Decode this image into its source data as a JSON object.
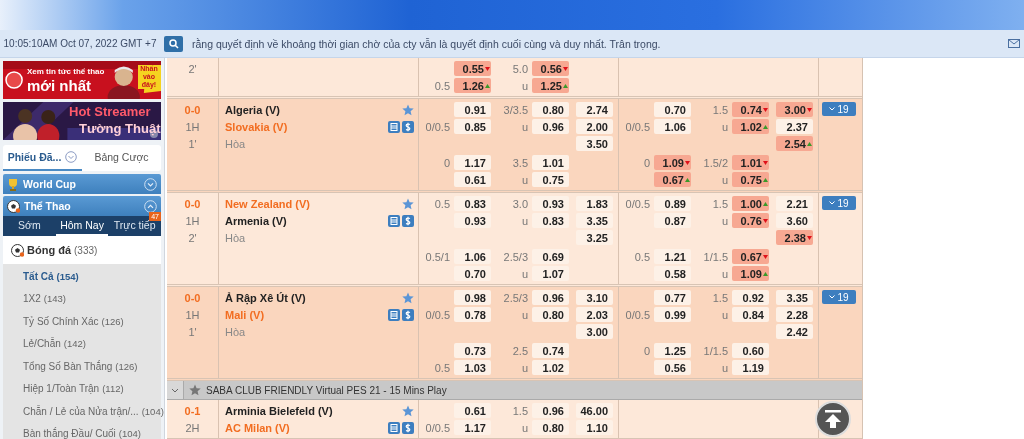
{
  "header": {
    "clock": "10:05:10AM Oct 07, 2022 GMT +7",
    "notice": "rằng quyết định về khoảng thời gian chờ của cty vẫn là quyết định cuối cùng và duy nhất. Trân trọng."
  },
  "sidebar": {
    "banners": [
      {
        "kind": "news",
        "lines": [
          "Xem tin tức thể thao",
          "mới nhất"
        ],
        "tag": "Nhấn vào đây!"
      },
      {
        "kind": "stream",
        "lines": [
          "Hot Streamer",
          "Tường Thuật"
        ]
      }
    ],
    "tabs": [
      {
        "label": "Phiếu Đã...",
        "selected": true
      },
      {
        "label": "Bảng Cược",
        "selected": false
      }
    ],
    "sections": [
      {
        "title": "World Cup",
        "kind": "trophy",
        "expanded": false
      },
      {
        "title": "Thể Thao",
        "kind": "ball",
        "expanded": true
      }
    ],
    "subtabs": [
      {
        "label": "Sớm",
        "selected": false
      },
      {
        "label": "Hôm Nay",
        "selected": true
      },
      {
        "label": "Trực tiếp",
        "selected": false,
        "badge": "47"
      }
    ],
    "sport": {
      "name": "Bóng đá",
      "count": "(333)"
    },
    "bet_types": [
      {
        "label": "Tất Cả",
        "count": "(154)",
        "selected": true
      },
      {
        "label": "1X2",
        "count": "(143)",
        "selected": false
      },
      {
        "label": "Tỷ Số Chính Xác",
        "count": "(126)",
        "selected": false
      },
      {
        "label": "Lẻ/Chẵn",
        "count": "(142)",
        "selected": false
      },
      {
        "label": "Tổng Số Bàn Thắng",
        "count": "(126)",
        "selected": false
      },
      {
        "label": "Hiệp 1/Toàn Trận",
        "count": "(112)",
        "selected": false
      },
      {
        "label": "Chẵn / Lẻ của Nửa trận/...",
        "count": "(104)",
        "selected": false
      },
      {
        "label": "Bàn thắng Đầu/ Cuối",
        "count": "(104)",
        "selected": false
      }
    ]
  },
  "table": {
    "rows": [
      {
        "kind": "match",
        "highlighted": false,
        "minute": "2'",
        "ft": [
          [
            {
              "hdp_odd": {
                "value": "0.55",
                "changed": true,
                "rising": false
              },
              "ou": "5.0",
              "ou_odd": {
                "value": "0.56",
                "changed": true,
                "rising": false
              }
            },
            {
              "hdp": "0.5",
              "hdp_odd": {
                "value": "1.26",
                "changed": true,
                "rising": true
              },
              "ou": "u",
              "ou_odd": {
                "value": "1.25",
                "changed": true,
                "rising": true
              }
            }
          ]
        ]
      },
      {
        "kind": "match",
        "highlighted": true,
        "score": "0-0",
        "period": "1H",
        "minute": "1'",
        "home": {
          "name": "Algeria (V)",
          "favorite": false
        },
        "away": {
          "name": "Slovakia (V)",
          "favorite": true
        },
        "draw": "Hòa",
        "more": "19",
        "ft": [
          [
            {
              "hdp_odd": {
                "value": "0.91"
              },
              "ou": "3/3.5",
              "ou_odd": {
                "value": "0.80"
              },
              "x12": {
                "value": "2.74"
              }
            },
            {
              "hdp": "0/0.5",
              "hdp_odd": {
                "value": "0.85"
              },
              "ou": "u",
              "ou_odd": {
                "value": "0.96"
              },
              "x12": {
                "value": "2.00"
              }
            },
            {
              "x12": {
                "value": "3.50"
              }
            }
          ],
          [
            {
              "hdp": "0",
              "hdp_odd": {
                "value": "1.17"
              },
              "ou": "3.5",
              "ou_odd": {
                "value": "1.01"
              }
            },
            {
              "hdp_odd": {
                "value": "0.61"
              },
              "ou": "u",
              "ou_odd": {
                "value": "0.75"
              }
            }
          ]
        ],
        "ht": [
          [
            {
              "hdp_odd": {
                "value": "0.70"
              },
              "ou": "1.5",
              "ou_odd": {
                "value": "0.74",
                "changed": true,
                "rising": false
              },
              "x12": {
                "value": "3.00",
                "changed": true,
                "rising": false
              }
            },
            {
              "hdp": "0/0.5",
              "hdp_odd": {
                "value": "1.06"
              },
              "ou": "u",
              "ou_odd": {
                "value": "1.02",
                "changed": true,
                "rising": true
              },
              "x12": {
                "value": "2.37"
              }
            },
            {
              "x12": {
                "value": "2.54",
                "changed": true,
                "rising": true
              }
            }
          ],
          [
            {
              "hdp": "0",
              "hdp_odd": {
                "value": "1.09",
                "changed": true,
                "rising": false
              },
              "ou": "1.5/2",
              "ou_odd": {
                "value": "1.01",
                "changed": true,
                "rising": false
              }
            },
            {
              "hdp_odd": {
                "value": "0.67",
                "changed": true,
                "rising": true
              },
              "ou": "u",
              "ou_odd": {
                "value": "0.75",
                "changed": true,
                "rising": true
              }
            }
          ]
        ]
      },
      {
        "kind": "match",
        "highlighted": false,
        "score": "0-0",
        "period": "1H",
        "minute": "2'",
        "home": {
          "name": "New Zealand (V)",
          "favorite": true
        },
        "away": {
          "name": "Armenia (V)",
          "favorite": false
        },
        "draw": "Hòa",
        "more": "19",
        "ft": [
          [
            {
              "hdp": "0.5",
              "hdp_odd": {
                "value": "0.83"
              },
              "ou": "3.0",
              "ou_odd": {
                "value": "0.93"
              },
              "x12": {
                "value": "1.83"
              }
            },
            {
              "hdp_odd": {
                "value": "0.93"
              },
              "ou": "u",
              "ou_odd": {
                "value": "0.83"
              },
              "x12": {
                "value": "3.35"
              }
            },
            {
              "x12": {
                "value": "3.25"
              }
            }
          ],
          [
            {
              "hdp": "0.5/1",
              "hdp_odd": {
                "value": "1.06"
              },
              "ou": "2.5/3",
              "ou_odd": {
                "value": "0.69"
              }
            },
            {
              "hdp_odd": {
                "value": "0.70"
              },
              "ou": "u",
              "ou_odd": {
                "value": "1.07"
              }
            }
          ]
        ],
        "ht": [
          [
            {
              "hdp": "0/0.5",
              "hdp_odd": {
                "value": "0.89"
              },
              "ou": "1.5",
              "ou_odd": {
                "value": "1.00",
                "changed": true,
                "rising": true
              },
              "x12": {
                "value": "2.21"
              }
            },
            {
              "hdp_odd": {
                "value": "0.87"
              },
              "ou": "u",
              "ou_odd": {
                "value": "0.76",
                "changed": true,
                "rising": false
              },
              "x12": {
                "value": "3.60"
              }
            },
            {
              "x12": {
                "value": "2.38",
                "changed": true,
                "rising": false
              }
            }
          ],
          [
            {
              "hdp": "0.5",
              "hdp_odd": {
                "value": "1.21"
              },
              "ou": "1/1.5",
              "ou_odd": {
                "value": "0.67",
                "changed": true,
                "rising": false
              }
            },
            {
              "hdp_odd": {
                "value": "0.58"
              },
              "ou": "u",
              "ou_odd": {
                "value": "1.09",
                "changed": true,
                "rising": true
              }
            }
          ]
        ]
      },
      {
        "kind": "match",
        "highlighted": true,
        "score": "0-0",
        "period": "1H",
        "minute": "1'",
        "home": {
          "name": "Ả Rập Xê Út (V)",
          "favorite": false
        },
        "away": {
          "name": "Mali (V)",
          "favorite": true
        },
        "draw": "Hòa",
        "more": "19",
        "ft": [
          [
            {
              "hdp_odd": {
                "value": "0.98"
              },
              "ou": "2.5/3",
              "ou_odd": {
                "value": "0.96"
              },
              "x12": {
                "value": "3.10"
              }
            },
            {
              "hdp": "0/0.5",
              "hdp_odd": {
                "value": "0.78"
              },
              "ou": "u",
              "ou_odd": {
                "value": "0.80"
              },
              "x12": {
                "value": "2.03"
              }
            },
            {
              "x12": {
                "value": "3.00"
              }
            }
          ],
          [
            {
              "hdp_odd": {
                "value": "0.73"
              },
              "ou": "2.5",
              "ou_odd": {
                "value": "0.74"
              }
            },
            {
              "hdp": "0.5",
              "hdp_odd": {
                "value": "1.03"
              },
              "ou": "u",
              "ou_odd": {
                "value": "1.02"
              }
            }
          ]
        ],
        "ht": [
          [
            {
              "hdp_odd": {
                "value": "0.77"
              },
              "ou": "1.5",
              "ou_odd": {
                "value": "0.92"
              },
              "x12": {
                "value": "3.35"
              }
            },
            {
              "hdp": "0/0.5",
              "hdp_odd": {
                "value": "0.99"
              },
              "ou": "u",
              "ou_odd": {
                "value": "0.84"
              },
              "x12": {
                "value": "2.28"
              }
            },
            {
              "x12": {
                "value": "2.42"
              }
            }
          ],
          [
            {
              "hdp": "0",
              "hdp_odd": {
                "value": "1.25"
              },
              "ou": "1/1.5",
              "ou_odd": {
                "value": "0.60"
              }
            },
            {
              "hdp_odd": {
                "value": "0.56"
              },
              "ou": "u",
              "ou_odd": {
                "value": "1.19"
              }
            }
          ]
        ]
      },
      {
        "kind": "league",
        "title": "SABA CLUB FRIENDLY Virtual PES 21 - 15 Mins Play"
      },
      {
        "kind": "match",
        "highlighted": false,
        "score": "0-1",
        "period": "2H",
        "home": {
          "name": "Arminia Bielefeld (V)",
          "favorite": false
        },
        "away": {
          "name": "AC Milan (V)",
          "favorite": true
        },
        "ft": [
          [
            {
              "hdp_odd": {
                "value": "0.61"
              },
              "ou": "1.5",
              "ou_odd": {
                "value": "0.96"
              },
              "x12": {
                "value": "46.00"
              }
            },
            {
              "hdp": "0/0.5",
              "hdp_odd": {
                "value": "1.17"
              },
              "ou": "u",
              "ou_odd": {
                "value": "0.80"
              },
              "x12": {
                "value": "1.10"
              }
            }
          ]
        ]
      }
    ]
  }
}
